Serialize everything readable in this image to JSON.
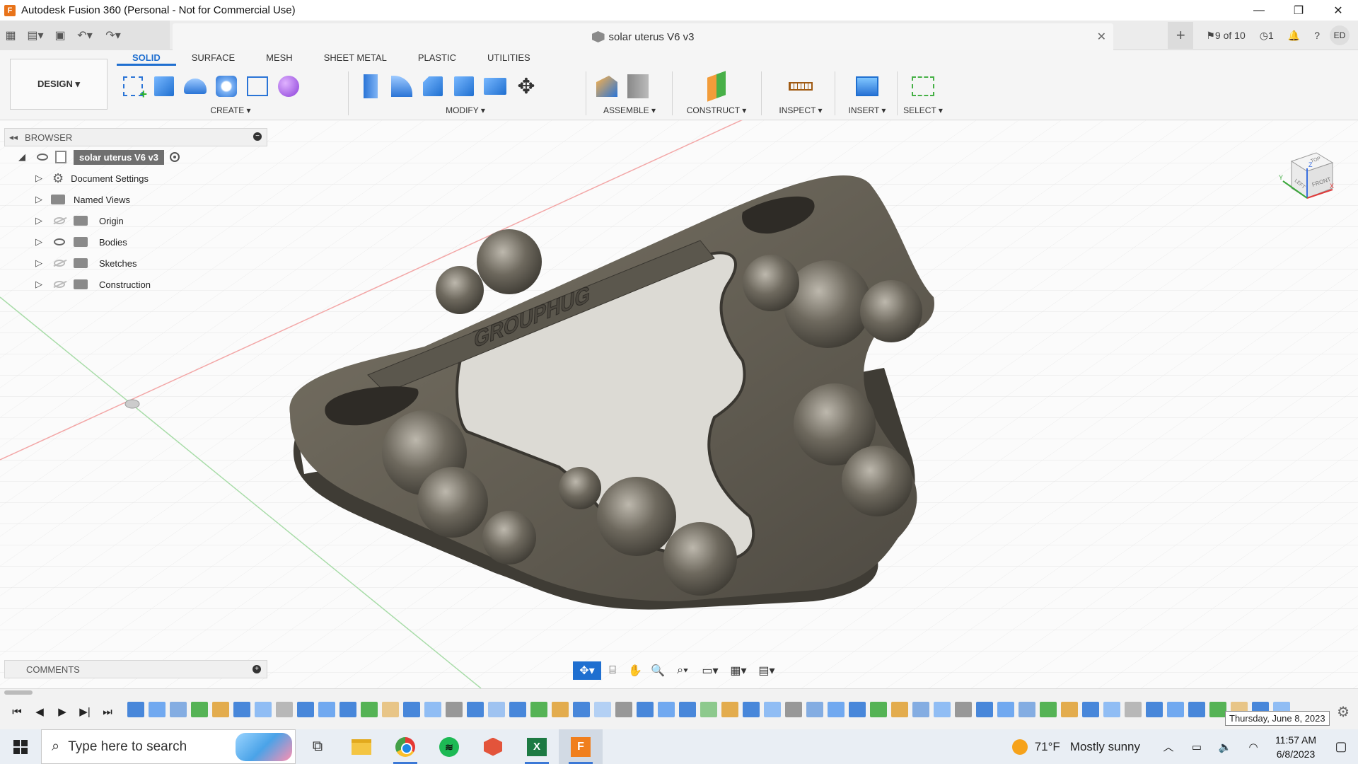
{
  "window": {
    "title": "Autodesk Fusion 360 (Personal - Not for Commercial Use)",
    "app_icon_letter": "F"
  },
  "appbar": {
    "document_title": "solar uterus V6 v3",
    "job_status": "9 of 10",
    "clock_count": "1",
    "avatar_initials": "ED"
  },
  "toolbar": {
    "workspace": "DESIGN ▾",
    "tabs": [
      "SOLID",
      "SURFACE",
      "MESH",
      "SHEET METAL",
      "PLASTIC",
      "UTILITIES"
    ],
    "groups": {
      "create": "CREATE ▾",
      "modify": "MODIFY ▾",
      "assemble": "ASSEMBLE ▾",
      "construct": "CONSTRUCT ▾",
      "inspect": "INSPECT ▾",
      "insert": "INSERT ▾",
      "select": "SELECT ▾"
    }
  },
  "browser": {
    "header": "BROWSER",
    "root": "solar uterus V6 v3",
    "items": [
      {
        "label": "Document Settings",
        "icon": "gear-icon",
        "visibility": "none"
      },
      {
        "label": "Named Views",
        "icon": "folder-icon",
        "visibility": "none"
      },
      {
        "label": "Origin",
        "icon": "folder-icon",
        "visibility": "hidden"
      },
      {
        "label": "Bodies",
        "icon": "folder-icon",
        "visibility": "visible"
      },
      {
        "label": "Sketches",
        "icon": "folder-icon",
        "visibility": "hidden"
      },
      {
        "label": "Construction",
        "icon": "folder-icon",
        "visibility": "hidden"
      }
    ]
  },
  "model": {
    "engraved_text": "GROUPHUG"
  },
  "viewcube": {
    "top": "TOP",
    "front": "FRONT",
    "left": "LEFT",
    "axis_z": "Z",
    "axis_x": "X",
    "axis_y": "Y"
  },
  "comments": {
    "header": "COMMENTS"
  },
  "timeline": {
    "tooltip": "Thursday, June 8, 2023",
    "feature_count": 55
  },
  "taskbar": {
    "search_placeholder": "Type here to search",
    "weather_temp": "71°F",
    "weather_desc": "Mostly sunny",
    "time": "11:57 AM",
    "date": "6/8/2023"
  },
  "colors": {
    "accent": "#1f6fd0",
    "model_body": "#6b655a",
    "fusion_orange": "#f07f1d"
  }
}
